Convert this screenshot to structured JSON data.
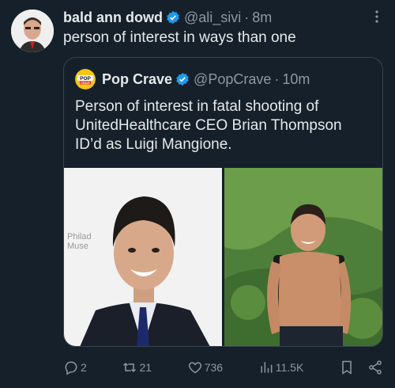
{
  "tweet": {
    "author_name": "bald ann dowd",
    "author_handle": "@ali_sivi",
    "separator": "·",
    "time": "8m",
    "text": "person of interest in ways than one"
  },
  "quoted": {
    "logo_text_top": "POP",
    "logo_text_bottom": "CRAVE",
    "author_name": "Pop Crave",
    "author_handle": "@PopCrave",
    "separator": "·",
    "time": "10m",
    "text": "Person of interest in fatal shooting of UnitedHealthcare CEO Brian Thompson ID’d as Luigi Mangione.",
    "photo1_bg_text_1": "Philad",
    "photo1_bg_text_2": "Muse"
  },
  "actions": {
    "replies": "2",
    "reposts": "21",
    "likes": "736",
    "views": "11.5K"
  },
  "colors": {
    "background": "#15202b",
    "verified": "#1d9bf0",
    "muted": "#8b98a5",
    "border": "#38444d",
    "popcrave_yellow": "#f5c518"
  }
}
